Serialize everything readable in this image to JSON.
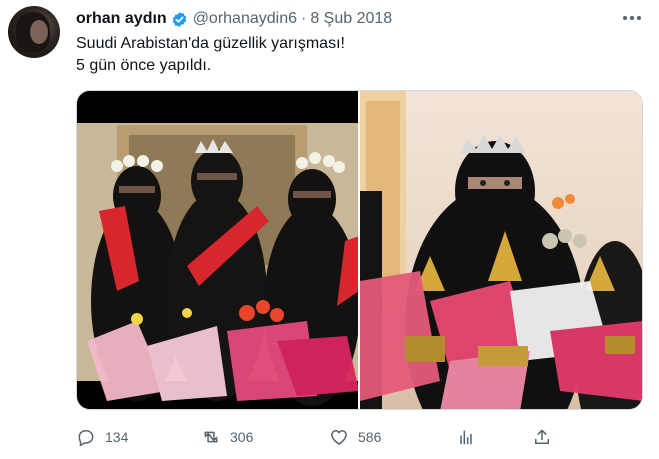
{
  "author": {
    "name": "orhan aydın",
    "handle": "@orhanaydin6",
    "separator": "·",
    "date": "8 Şub 2018"
  },
  "tweet": {
    "lines": [
      "Suudi Arabistan'da güzellik yarışması!",
      "5 gün önce yapıldı."
    ]
  },
  "media": {
    "images": [
      "photo-left",
      "photo-right"
    ]
  },
  "actions": {
    "reply_count": "134",
    "retweet_count": "306",
    "like_count": "586"
  },
  "icons": [
    "verified-icon",
    "more-icon",
    "reply-icon",
    "retweet-icon",
    "like-icon",
    "analytics-icon",
    "share-icon"
  ],
  "colors": {
    "text": "#0f1419",
    "secondary": "#536471",
    "verified": "#1d9bf0",
    "sash": "#d8262e"
  }
}
